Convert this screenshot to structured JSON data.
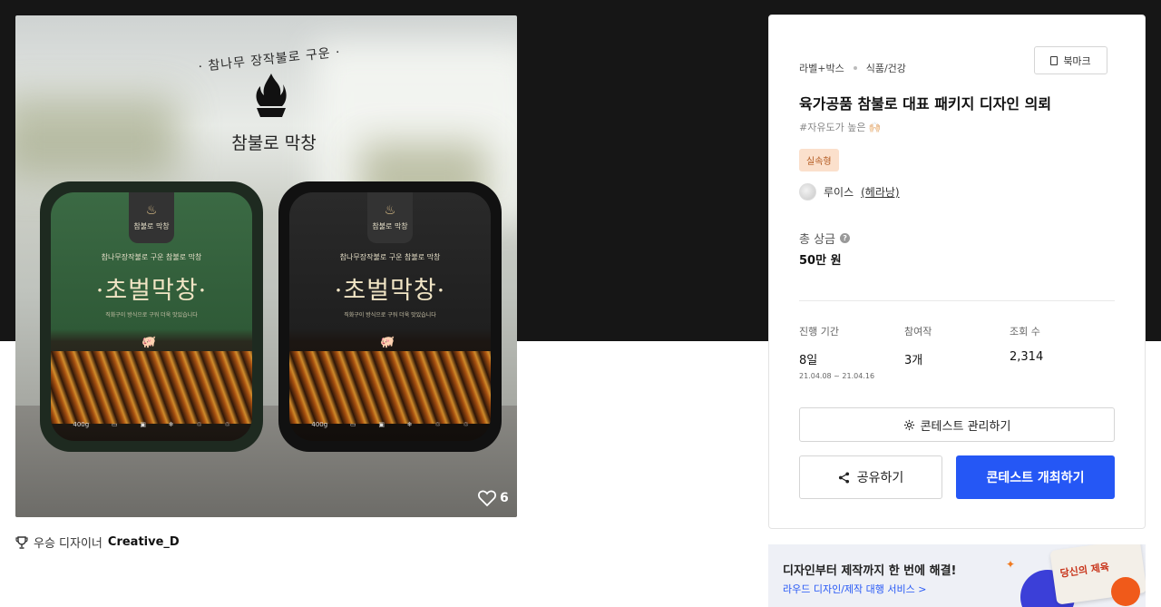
{
  "hero": {
    "brand_arc": "· 참나무 장작불로 구운 ·",
    "brand_name": "참불로 막창",
    "trays": [
      {
        "tab": "참불로 막창",
        "sub": "참나무장작불로 구운 참불로 막창",
        "product": "·초벌막창·",
        "tiny": "직화구이 방식으로 구워 더욱 맛있습니다",
        "weight": "400g"
      },
      {
        "tab": "참불로 막창",
        "sub": "참나무장작불로 구운 참불로 막창",
        "product": "·초벌막창·",
        "tiny": "직화구이 방식으로 구워 더욱 맛있습니다",
        "weight": "400g"
      }
    ],
    "likes": "6",
    "like_icon": "heart-icon"
  },
  "winner": {
    "icon": "trophy-icon",
    "label": "우승 디자이너",
    "name": "Creative_D"
  },
  "card": {
    "breadcrumb": [
      "라벨+박스",
      "식품/건강"
    ],
    "bookmark_label": "북마크",
    "title": "육가공품 참불로 대표 패키지 디자인 의뢰",
    "tagline": "#자유도가 높은 🙌🏻",
    "badge": "실속형",
    "host_name": "루이스",
    "host_id": "(헤라낭)",
    "prize_label": "총 상금",
    "prize_value": "50만 원",
    "stats": [
      {
        "label": "진행 기간",
        "value": "8일",
        "range": "21.04.08 ~ 21.04.16"
      },
      {
        "label": "참여작",
        "value": "3개"
      },
      {
        "label": "조회 수",
        "value": "2,314"
      }
    ],
    "manage_label": "콘테스트 관리하기",
    "share_label": "공유하기",
    "host_contest_label": "콘테스트 개최하기",
    "accent_color": "#2557f5"
  },
  "banner": {
    "headline": "디자인부터 제작까지 한 번에 해결!",
    "link": "라우드 디자인/제작 대행 서비스 >",
    "box_logo": "당신의 제육"
  }
}
